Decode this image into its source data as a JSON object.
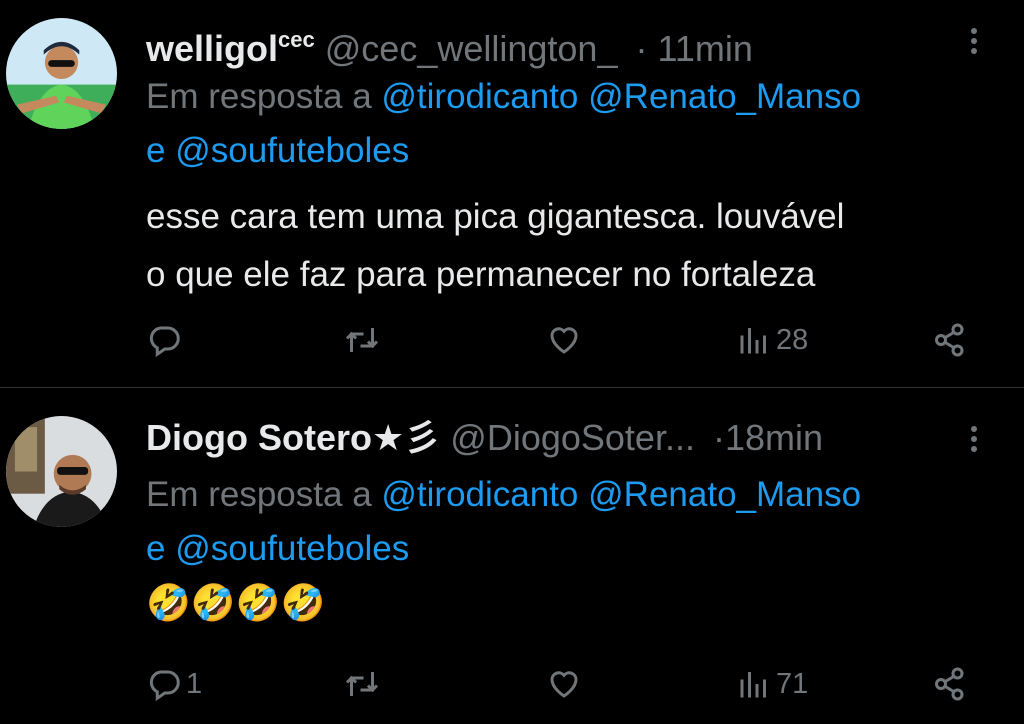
{
  "tweets": [
    {
      "name": "welligol",
      "name_sup": "cec",
      "handle": "@cec_wellington_",
      "separator": "·",
      "time": "11min",
      "reply_prefix": "Em resposta a",
      "mentions": [
        "@tirodicanto",
        "@Renato_Manso"
      ],
      "conjunction": "e",
      "last_mention": "@soufuteboles",
      "text_line1": "esse cara tem uma pica gigantesca. louvável",
      "text_line2": "o que ele faz para permanecer no fortaleza",
      "reply_count": "",
      "views": "28"
    },
    {
      "name": "Diogo Sotero★彡",
      "handle": "@DiogoSoter...",
      "separator": "·",
      "time": "18min",
      "reply_prefix": "Em resposta a",
      "mentions": [
        "@tirodicanto",
        "@Renato_Manso"
      ],
      "conjunction": "e",
      "last_mention": "@soufuteboles",
      "emojis": "🤣🤣🤣🤣",
      "reply_count": "1",
      "views": "71"
    }
  ],
  "colors": {
    "background": "#000000",
    "primary_text": "#e7e9ea",
    "secondary_text": "#71767b",
    "link": "#1d9bf0",
    "divider": "#2f3336"
  },
  "icons": {
    "reply": "reply-icon",
    "retweet": "retweet-icon",
    "like": "heart-icon",
    "views": "views-chart-icon",
    "share": "share-icon",
    "more": "more-vertical-icon"
  }
}
